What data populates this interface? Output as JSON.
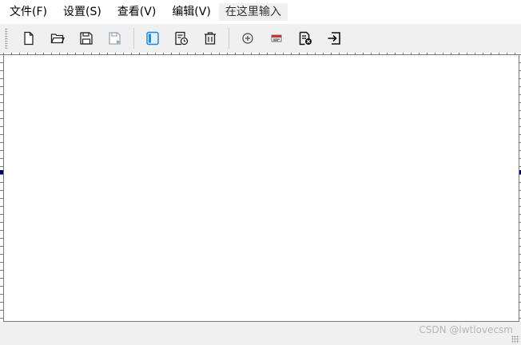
{
  "menu": {
    "file": "文件(F)",
    "settings": "设置(S)",
    "view": "查看(V)",
    "edit": "编辑(V)",
    "type_here": "在这里输入"
  },
  "toolbar": {
    "icons": [
      "new-file-icon",
      "open-folder-icon",
      "save-icon",
      "save-as-icon",
      "panel-icon",
      "history-icon",
      "delete-icon",
      "add-circle-icon",
      "flag-icon",
      "export-doc-icon",
      "exit-icon"
    ]
  },
  "watermark": "CSDN @lwtlovecsm",
  "colors": {
    "accent": "#1e88e5",
    "handle": "#000080",
    "toolbar_bg": "#f0f0f0"
  }
}
